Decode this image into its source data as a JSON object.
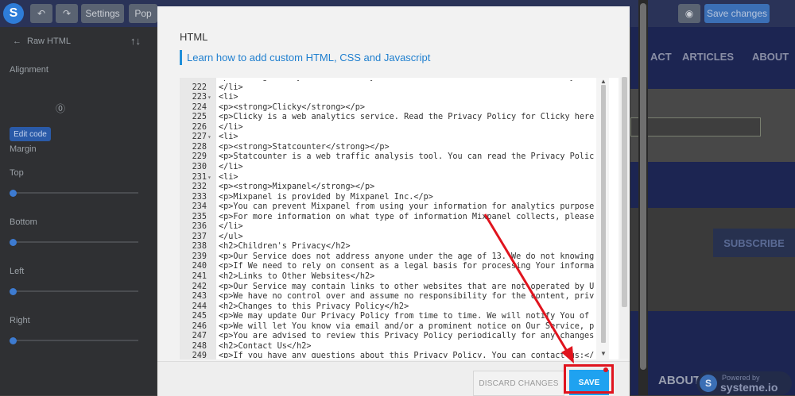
{
  "colors": {
    "accent": "#1fa2f0",
    "link": "#1f7fcf",
    "highlight": "#e0141e",
    "topbar": "#2a3358"
  },
  "topbar": {
    "logo_letter": "S",
    "settings_label": "Settings",
    "pages_label": "Pop",
    "save_changes_label": "Save changes",
    "icons": [
      "undo-icon",
      "redo-icon",
      "preview-icon"
    ]
  },
  "sidebar": {
    "back_label": "Raw HTML",
    "alignment_label": "Alignment",
    "edit_code_label": "Edit code",
    "margin_label": "Margin",
    "top_label": "Top",
    "bottom_label": "Bottom",
    "left_label": "Left",
    "right_label": "Right"
  },
  "background_page": {
    "nav_items": [
      "ACT",
      "ARTICLES",
      "ABOUT"
    ],
    "subscribe_label": "SUBSCRIBE",
    "about_label": "ABOUT",
    "powered_by": "Powered by",
    "brand": "systeme.io"
  },
  "modal": {
    "title": "HTML",
    "help_link": "Learn how to add custom HTML, CSS and Javascript",
    "discard_label": "DISCARD CHANGES",
    "save_label": "SAVE",
    "code_lines": [
      {
        "num": "",
        "fold": false,
        "text": "<p><strong>Clicky is a web analytics service. You can visit their Privacy Policy page"
      },
      {
        "num": "222",
        "fold": false,
        "text": "</li>"
      },
      {
        "num": "223",
        "fold": true,
        "text": "<li>"
      },
      {
        "num": "224",
        "fold": false,
        "text": "<p><strong>Clicky</strong></p>"
      },
      {
        "num": "225",
        "fold": false,
        "text": "<p>Clicky is a web analytics service. Read the Privacy Policy for Clicky here"
      },
      {
        "num": "226",
        "fold": false,
        "text": "</li>"
      },
      {
        "num": "227",
        "fold": true,
        "text": "<li>"
      },
      {
        "num": "228",
        "fold": false,
        "text": "<p><strong>Statcounter</strong></p>"
      },
      {
        "num": "229",
        "fold": false,
        "text": "<p>Statcounter is a web traffic analysis tool. You can read the Privacy Polic"
      },
      {
        "num": "230",
        "fold": false,
        "text": "</li>"
      },
      {
        "num": "231",
        "fold": true,
        "text": "<li>"
      },
      {
        "num": "232",
        "fold": false,
        "text": "<p><strong>Mixpanel</strong></p>"
      },
      {
        "num": "233",
        "fold": false,
        "text": "<p>Mixpanel is provided by Mixpanel Inc.</p>"
      },
      {
        "num": "234",
        "fold": false,
        "text": "<p>You can prevent Mixpanel from using your information for analytics purpose"
      },
      {
        "num": "235",
        "fold": false,
        "text": "<p>For more information on what type of information Mixpanel collects, please"
      },
      {
        "num": "236",
        "fold": false,
        "text": "</li>"
      },
      {
        "num": "237",
        "fold": false,
        "text": "</ul>"
      },
      {
        "num": "238",
        "fold": false,
        "text": "<h2>Children's Privacy</h2>"
      },
      {
        "num": "239",
        "fold": false,
        "text": "<p>Our Service does not address anyone under the age of 13. We do not knowing"
      },
      {
        "num": "240",
        "fold": false,
        "text": "<p>If We need to rely on consent as a legal basis for processing Your informa"
      },
      {
        "num": "241",
        "fold": false,
        "text": "<h2>Links to Other Websites</h2>"
      },
      {
        "num": "242",
        "fold": false,
        "text": "<p>Our Service may contain links to other websites that are not operated by U"
      },
      {
        "num": "243",
        "fold": false,
        "text": "<p>We have no control over and assume no responsibility for the content, priv"
      },
      {
        "num": "244",
        "fold": false,
        "text": "<h2>Changes to this Privacy Policy</h2>"
      },
      {
        "num": "245",
        "fold": false,
        "text": "<p>We may update Our Privacy Policy from time to time. We will notify You of"
      },
      {
        "num": "246",
        "fold": false,
        "text": "<p>We will let You know via email and/or a prominent notice on Our Service, p"
      },
      {
        "num": "247",
        "fold": false,
        "text": "<p>You are advised to review this Privacy Policy periodically for any changes"
      },
      {
        "num": "248",
        "fold": false,
        "text": "<h2>Contact Us</h2>"
      },
      {
        "num": "249",
        "fold": false,
        "text": "<p>If you have any questions about this Privacy Policy, You can contact us:</p"
      }
    ]
  }
}
